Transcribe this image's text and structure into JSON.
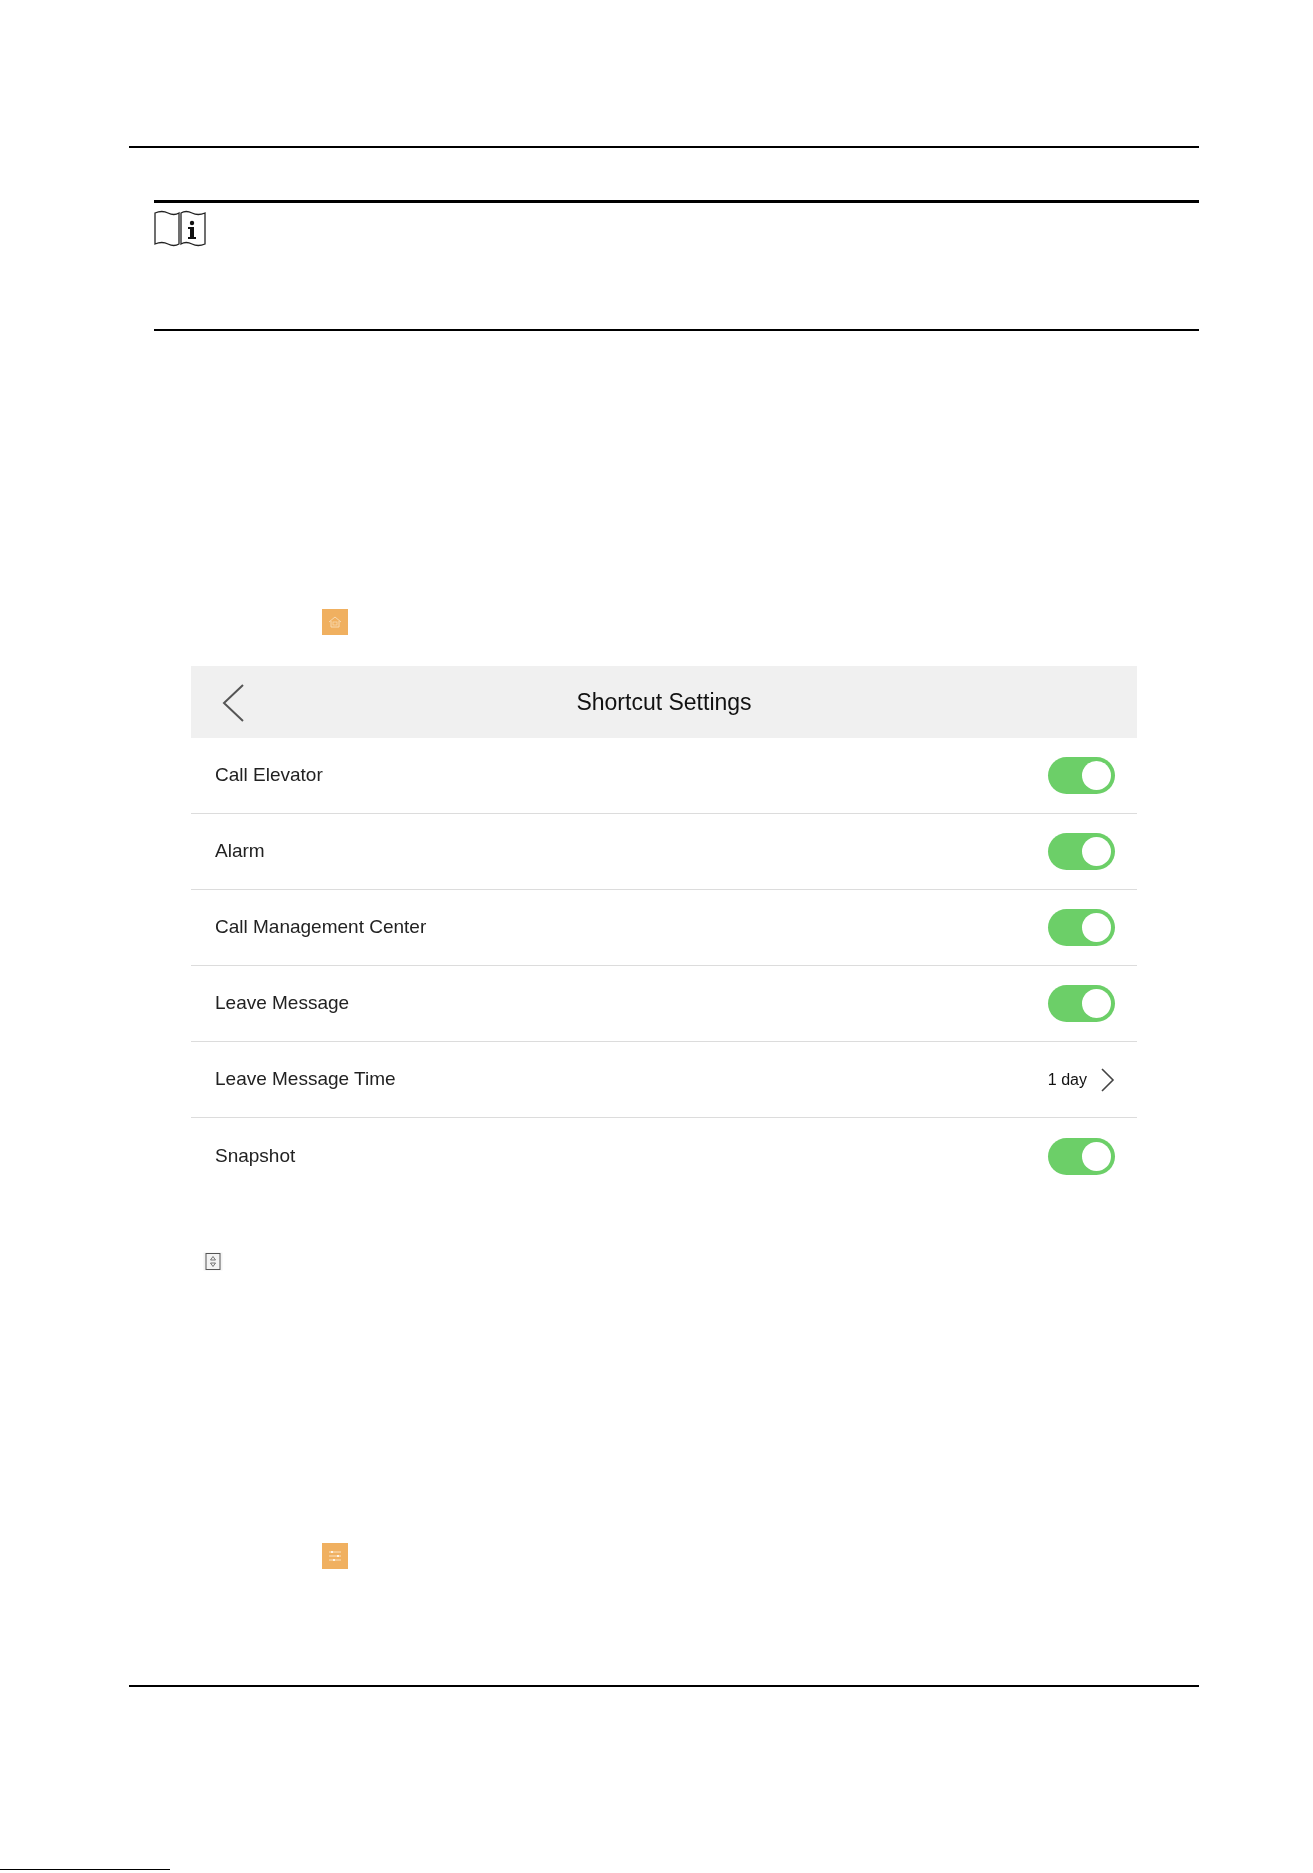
{
  "settings_screen": {
    "title": "Shortcut Settings"
  },
  "items": [
    {
      "kind": "toggle",
      "label": "Call Elevator",
      "on": true
    },
    {
      "kind": "toggle",
      "label": "Alarm",
      "on": true
    },
    {
      "kind": "toggle",
      "label": "Call Management Center",
      "on": true
    },
    {
      "kind": "toggle",
      "label": "Leave Message",
      "on": true
    },
    {
      "kind": "link",
      "label": "Leave Message Time",
      "value": "1 day"
    },
    {
      "kind": "toggle",
      "label": "Snapshot",
      "on": true
    }
  ]
}
